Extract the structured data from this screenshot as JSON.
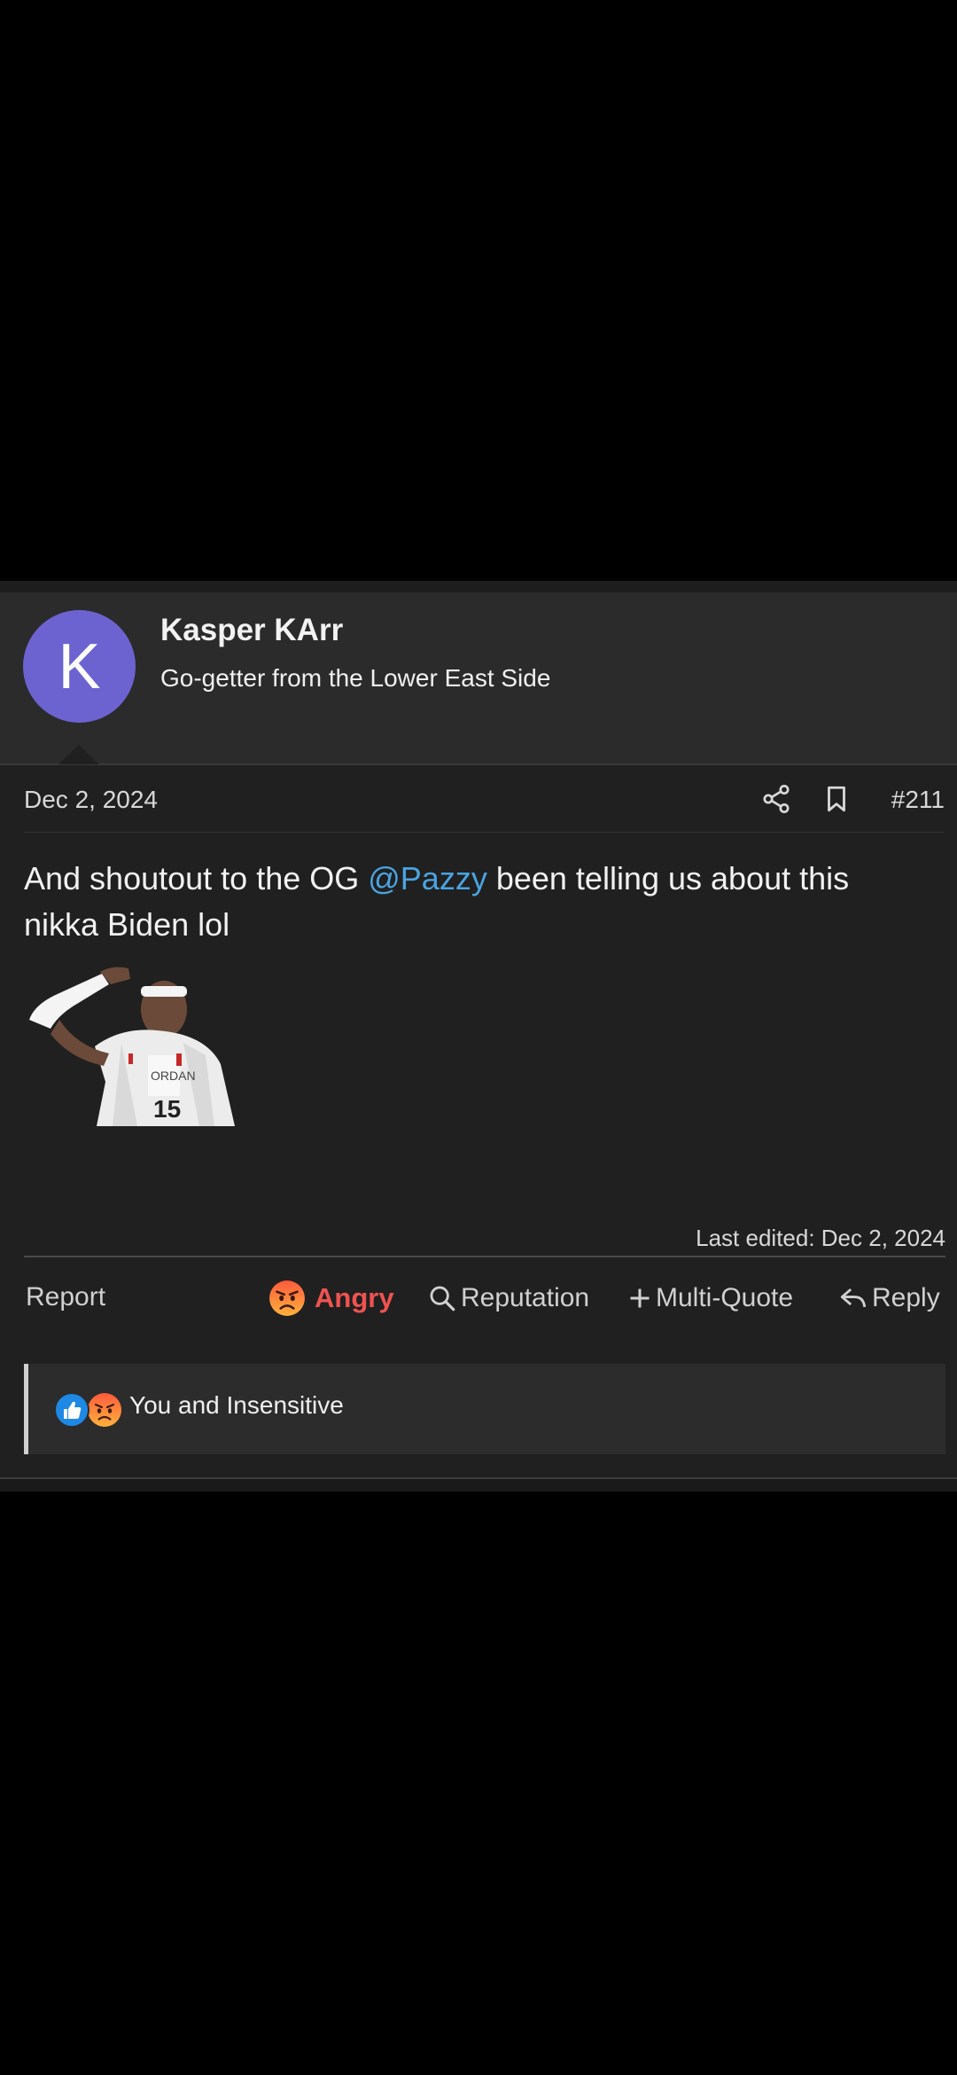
{
  "user": {
    "avatar_letter": "K",
    "avatar_color": "#6c63d1",
    "name": "Kasper KArr",
    "title": "Go-getter from the Lower East Side"
  },
  "post": {
    "date": "Dec 2, 2024",
    "number": "#211",
    "body_before": "And shoutout to the OG ",
    "mention": "@Pazzy",
    "body_after": " been telling us about this nikka Biden lol",
    "last_edited": "Last edited: Dec 2, 2024"
  },
  "actions": {
    "report": "Report",
    "angry": "Angry",
    "reputation": "Reputation",
    "multi_quote": "Multi-Quote",
    "reply": "Reply"
  },
  "reactions": {
    "summary": "You and Insensitive"
  },
  "colors": {
    "mention": "#4aa3e0",
    "angry": "#ef5350",
    "like": "#1e88e5"
  }
}
